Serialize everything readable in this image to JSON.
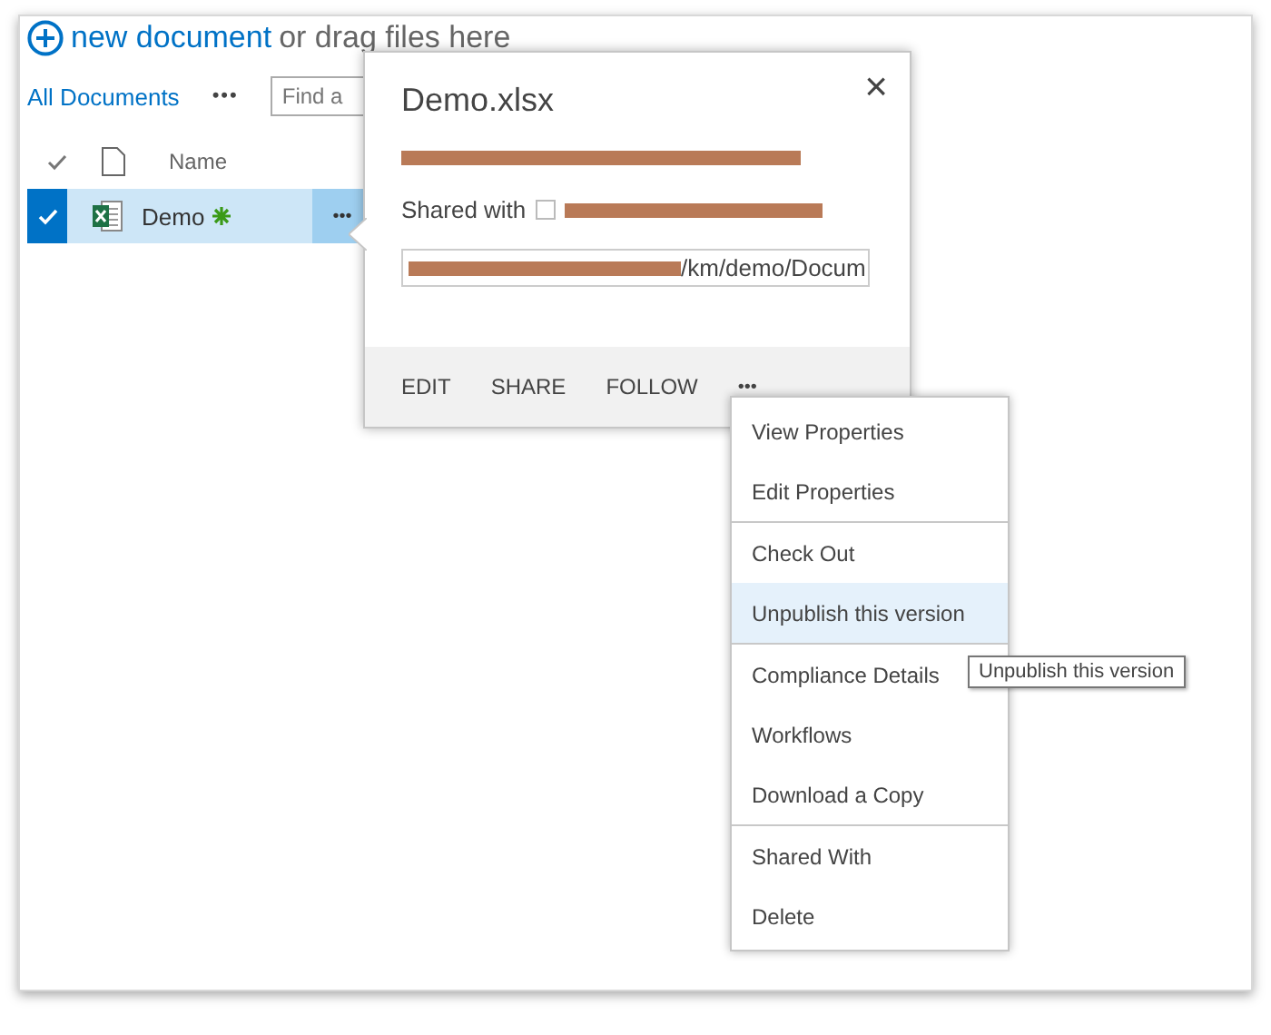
{
  "header": {
    "new_document": "new document",
    "drag_text": "or drag files here"
  },
  "views": {
    "current": "All Documents",
    "more": "•••",
    "search": {
      "placeholder": "Find a"
    }
  },
  "list": {
    "columns": [
      {
        "label": "Name"
      }
    ],
    "rows": [
      {
        "name": "Demo",
        "selected": true,
        "is_new": true,
        "menu": "•••"
      }
    ]
  },
  "callout": {
    "title": "Demo.xlsx",
    "close": "×",
    "shared_label": "Shared with",
    "url": "/km/demo/Docum",
    "actions": [
      "EDIT",
      "SHARE",
      "FOLLOW"
    ],
    "more": "•••"
  },
  "menu": {
    "groups": [
      [
        {
          "label": "View Properties",
          "selected": false
        },
        {
          "label": "Edit Properties",
          "selected": false
        }
      ],
      [
        {
          "label": "Check Out",
          "selected": false
        },
        {
          "label": "Unpublish this version",
          "selected": true
        }
      ],
      [
        {
          "label": "Compliance Details",
          "selected": false
        },
        {
          "label": "Workflows",
          "selected": false
        },
        {
          "label": "Download a Copy",
          "selected": false
        }
      ],
      [
        {
          "label": "Shared With",
          "selected": false
        },
        {
          "label": "Delete",
          "selected": false
        }
      ]
    ]
  },
  "tooltip": "Unpublish this version"
}
